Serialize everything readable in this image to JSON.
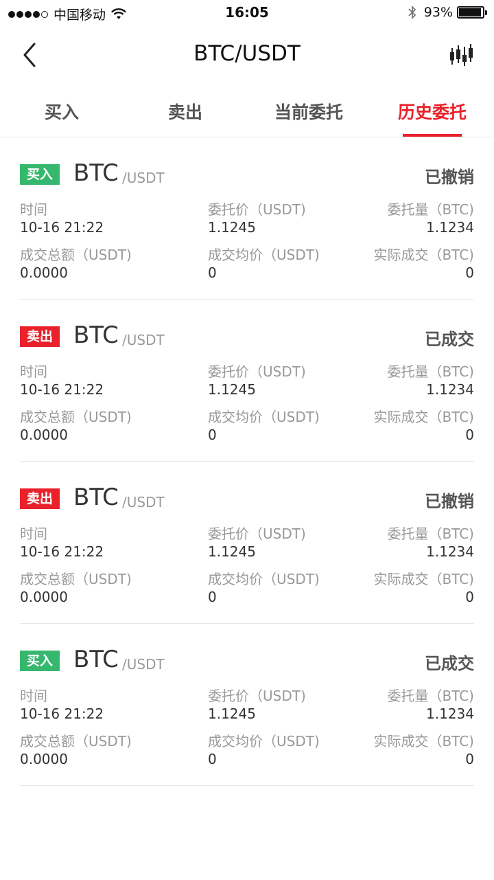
{
  "status_bar": {
    "carrier": "中国移动",
    "time": "16:05",
    "battery": "93%",
    "battery_level": 0.93,
    "signal_dots": 5,
    "signal_filled": 4
  },
  "nav": {
    "title": "BTC/USDT",
    "back_icon": "chevron-left-icon",
    "right_icon": "kline-chart-icon"
  },
  "tabs": [
    {
      "label": "买入",
      "active": false
    },
    {
      "label": "卖出",
      "active": false
    },
    {
      "label": "当前委托",
      "active": false
    },
    {
      "label": "历史委托",
      "active": true
    }
  ],
  "colors": {
    "accent": "#e8212b",
    "buy": "#35b86d",
    "sell": "#e8212b",
    "label": "#999999",
    "value": "#333333"
  },
  "labels": {
    "time": "时间",
    "order_price": "委托价（USDT)",
    "order_amount": "委托量（BTC)",
    "total": "成交总额（USDT)",
    "avg_price": "成交均价（USDT)",
    "filled": "实际成交（BTC)"
  },
  "orders": [
    {
      "side": "买入",
      "side_type": "buy",
      "base": "BTC",
      "quote": "/USDT",
      "status": "已撤销",
      "time": "10-16 21:22",
      "price": "1.1245",
      "amount": "1.1234",
      "total": "0.0000",
      "avg_price": "0",
      "filled": "0"
    },
    {
      "side": "卖出",
      "side_type": "sell",
      "base": "BTC",
      "quote": "/USDT",
      "status": "已成交",
      "time": "10-16 21:22",
      "price": "1.1245",
      "amount": "1.1234",
      "total": "0.0000",
      "avg_price": "0",
      "filled": "0"
    },
    {
      "side": "卖出",
      "side_type": "sell",
      "base": "BTC",
      "quote": "/USDT",
      "status": "已撤销",
      "time": "10-16 21:22",
      "price": "1.1245",
      "amount": "1.1234",
      "total": "0.0000",
      "avg_price": "0",
      "filled": "0"
    },
    {
      "side": "买入",
      "side_type": "buy",
      "base": "BTC",
      "quote": "/USDT",
      "status": "已成交",
      "time": "10-16 21:22",
      "price": "1.1245",
      "amount": "1.1234",
      "total": "0.0000",
      "avg_price": "0",
      "filled": "0"
    }
  ]
}
